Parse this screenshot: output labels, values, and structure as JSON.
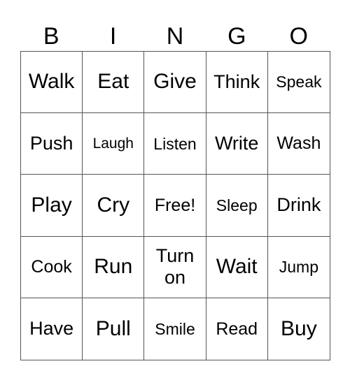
{
  "header": [
    "B",
    "I",
    "N",
    "G",
    "O"
  ],
  "cells": [
    "Walk",
    "Eat",
    "Give",
    "Think",
    "Speak",
    "Push",
    "Laugh",
    "Listen",
    "Write",
    "Wash",
    "Play",
    "Cry",
    "Free!",
    "Sleep",
    "Drink",
    "Cook",
    "Run",
    "Turn on",
    "Wait",
    "Jump",
    "Have",
    "Pull",
    "Smile",
    "Read",
    "Buy"
  ]
}
